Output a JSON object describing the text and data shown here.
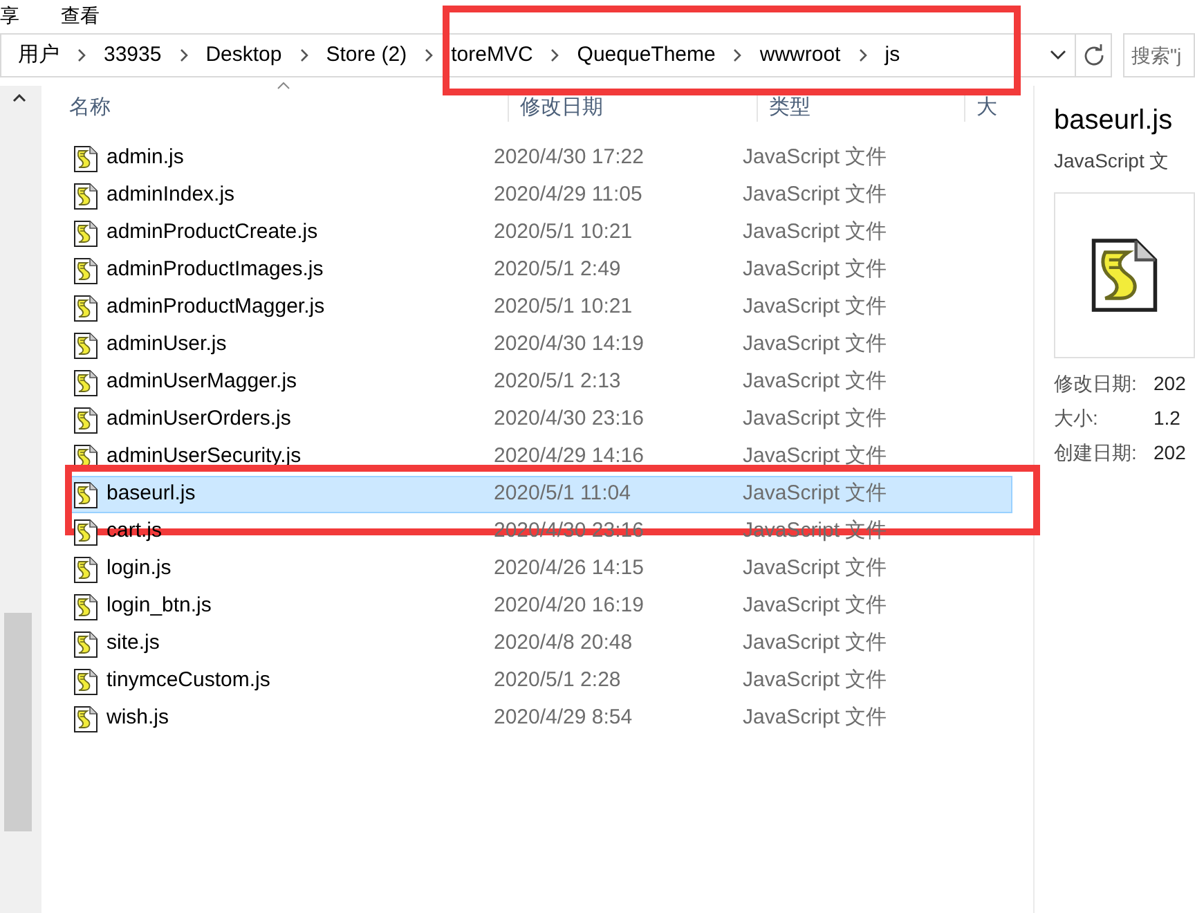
{
  "menu": [
    "享",
    "查看"
  ],
  "address_bar": {
    "crumbs": [
      "用户",
      "33935",
      "Desktop",
      "Store (2)",
      "toreMVC",
      "QuequeTheme",
      "wwwroot",
      "js"
    ],
    "marked": true
  },
  "search": {
    "placeholder": "搜索\"j"
  },
  "columns": [
    "名称",
    "修改日期",
    "类型",
    "大"
  ],
  "files": [
    {
      "name": "admin.js",
      "date": "2020/4/30 17:22",
      "type": "JavaScript 文件",
      "selected": false,
      "marked": false
    },
    {
      "name": "adminIndex.js",
      "date": "2020/4/29 11:05",
      "type": "JavaScript 文件",
      "selected": false,
      "marked": false
    },
    {
      "name": "adminProductCreate.js",
      "date": "2020/5/1 10:21",
      "type": "JavaScript 文件",
      "selected": false,
      "marked": false
    },
    {
      "name": "adminProductImages.js",
      "date": "2020/5/1 2:49",
      "type": "JavaScript 文件",
      "selected": false,
      "marked": false
    },
    {
      "name": "adminProductMagger.js",
      "date": "2020/5/1 10:21",
      "type": "JavaScript 文件",
      "selected": false,
      "marked": false
    },
    {
      "name": "adminUser.js",
      "date": "2020/4/30 14:19",
      "type": "JavaScript 文件",
      "selected": false,
      "marked": false
    },
    {
      "name": "adminUserMagger.js",
      "date": "2020/5/1 2:13",
      "type": "JavaScript 文件",
      "selected": false,
      "marked": false
    },
    {
      "name": "adminUserOrders.js",
      "date": "2020/4/30 23:16",
      "type": "JavaScript 文件",
      "selected": false,
      "marked": false
    },
    {
      "name": "adminUserSecurity.js",
      "date": "2020/4/29 14:16",
      "type": "JavaScript 文件",
      "selected": false,
      "marked": false
    },
    {
      "name": "baseurl.js",
      "date": "2020/5/1 11:04",
      "type": "JavaScript 文件",
      "selected": true,
      "marked": true
    },
    {
      "name": "cart.js",
      "date": "2020/4/30 23:16",
      "type": "JavaScript 文件",
      "selected": false,
      "marked": false
    },
    {
      "name": "login.js",
      "date": "2020/4/26 14:15",
      "type": "JavaScript 文件",
      "selected": false,
      "marked": false
    },
    {
      "name": "login_btn.js",
      "date": "2020/4/20 16:19",
      "type": "JavaScript 文件",
      "selected": false,
      "marked": false
    },
    {
      "name": "site.js",
      "date": "2020/4/8 20:48",
      "type": "JavaScript 文件",
      "selected": false,
      "marked": false
    },
    {
      "name": "tinymceCustom.js",
      "date": "2020/5/1 2:28",
      "type": "JavaScript 文件",
      "selected": false,
      "marked": false
    },
    {
      "name": "wish.js",
      "date": "2020/4/29 8:54",
      "type": "JavaScript 文件",
      "selected": false,
      "marked": false
    }
  ],
  "preview": {
    "title": "baseurl.js",
    "subtitle": "JavaScript 文",
    "details": [
      {
        "label": "修改日期:",
        "value": "202"
      },
      {
        "label": "大小:",
        "value": "1.2"
      },
      {
        "label": "创建日期:",
        "value": "202"
      }
    ]
  }
}
